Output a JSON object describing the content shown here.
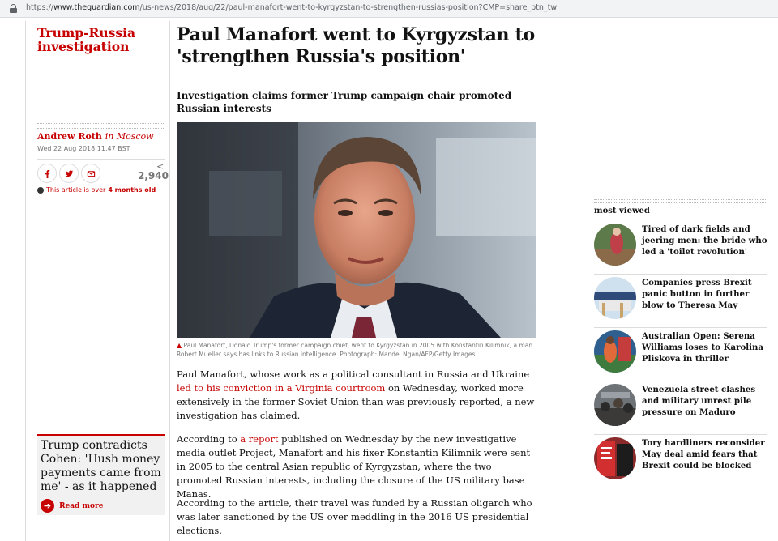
{
  "browser": {
    "url_scheme": "https://",
    "url_host": "www.theguardian.com",
    "url_path": "/us-news/2018/aug/22/paul-manafort-went-to-kyrgyzstan-to-strengthen-russias-position?CMP=share_btn_tw"
  },
  "section": {
    "label": "Trump-Russia investigation"
  },
  "article": {
    "headline": "Paul Manafort went to Kyrgyzstan to 'strengthen Russia's position'",
    "standfirst": "Investigation claims former Trump campaign chair promoted Russian interests",
    "author": "Andrew Roth",
    "author_location": "in Moscow",
    "published": "Wed 22 Aug 2018 11.47 BST",
    "share_count": "2,940",
    "age_note_prefix": "This article is over",
    "age_note_bold": "4 months old",
    "caption_marker": "▲",
    "caption": "Paul Manafort, Donald Trump's former campaign chief, went to Kyrgyzstan in 2005 with Konstantin Kilimnik, a man Robert Mueller says has links to Russian intelligence. Photograph: Mandel Ngan/AFP/Getty Images",
    "p1_before": "Paul Manafort, whose work as a political consultant in Russia and Ukraine ",
    "p1_link": "led to his conviction in a Virginia courtroom",
    "p1_after": " on Wednesday, worked more extensively in the former Soviet Union than was previously reported, a new investigation has claimed.",
    "p2_before": "According to ",
    "p2_link": "a report",
    "p2_after": " published on Wednesday by the new investigative media outlet Project, Manafort and his fixer Konstantin Kilimnik were sent in 2005 to the central Asian republic of Kyrgyzstan, where the two promoted Russian interests, including the closure of the US military base Manas.",
    "p3": "According to the article, their travel was funded by a Russian oligarch who was later sanctioned by the US over meddling in the 2016 US presidential elections."
  },
  "rich_link": {
    "title": "Trump contradicts Cohen: 'Hush money payments came from me' - as it happened",
    "more": "Read more"
  },
  "most_viewed": {
    "title": "most viewed",
    "items": [
      {
        "title": "Tired of dark fields and jeering men: the bride who led a 'toilet revolution'"
      },
      {
        "title": "Companies press Brexit panic button in further blow to Theresa May"
      },
      {
        "title": "Australian Open: Serena Williams loses to Karolina Pliskova in thriller"
      },
      {
        "title": "Venezuela street clashes and military unrest pile pressure on Maduro"
      },
      {
        "title": "Tory hardliners reconsider May deal amid fears that Brexit could be blocked"
      }
    ]
  },
  "colors": {
    "brand_red": "#c70000",
    "text": "#121212",
    "muted": "#767676",
    "rule": "#dcdcdc"
  },
  "icons": [
    "lock-icon",
    "facebook-icon",
    "twitter-icon",
    "email-icon",
    "clock-icon",
    "arrow-right-icon"
  ]
}
